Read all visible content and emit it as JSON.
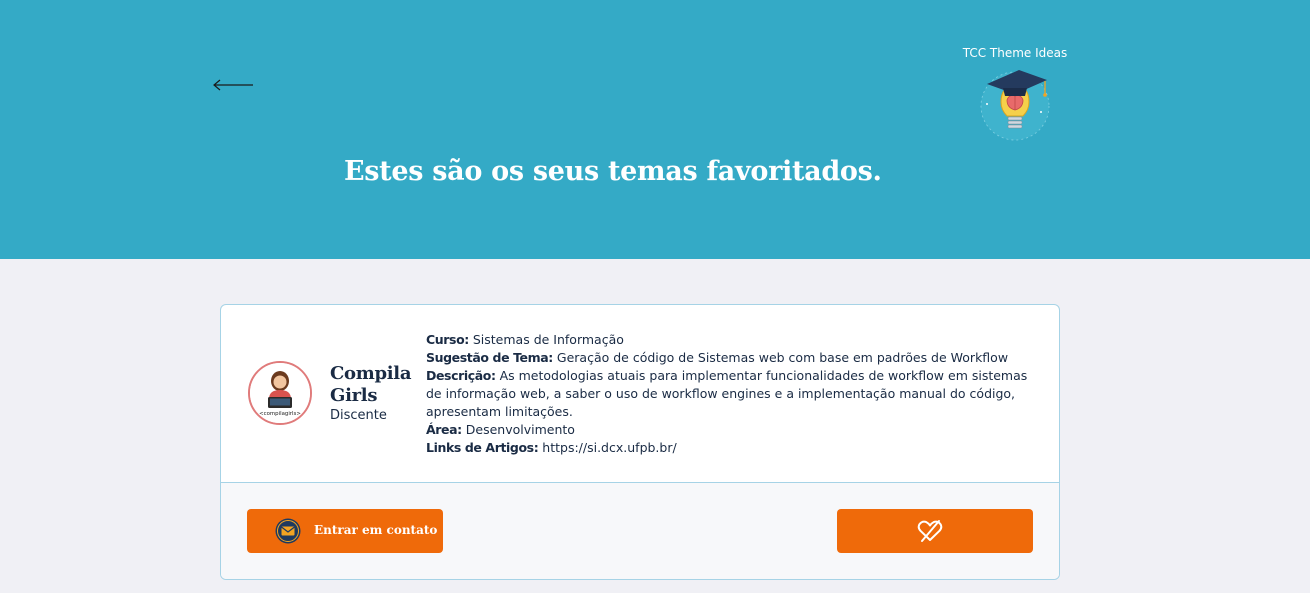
{
  "header": {
    "back_icon": "arrow-left-icon",
    "brand_name": "TCC Theme Ideas",
    "brand_logo_icon": "graduation-cap-lightbulb-icon",
    "title": "Estes são os seus temas favoritados."
  },
  "theme_card": {
    "author": {
      "avatar_icon": "compila-girls-avatar",
      "avatar_caption": "<compilagirls>",
      "name": "Compila Girls",
      "role": "Discente"
    },
    "fields": [
      {
        "label": "Curso:",
        "value": "Sistemas de Informação"
      },
      {
        "label": "Sugestão de Tema:",
        "value": "Geração de código de Sistemas web com base em padrões de Workflow"
      },
      {
        "label": "Descrição:",
        "value": "As metodologias atuais para implementar funcionalidades de workflow em sistemas de informação web, a saber o uso de workflow engines e a implementação manual do código, apresentam limitações."
      },
      {
        "label": "Área:",
        "value": "Desenvolvimento"
      },
      {
        "label": "Links de Artigos:",
        "value": "https://si.dcx.ufpb.br/"
      }
    ],
    "contact_button": {
      "label": "Entrar em contato",
      "icon": "envelope-icon"
    },
    "unfavorite_button": {
      "icon": "heart-crossed-icon"
    }
  },
  "colors": {
    "hero": "#34aac6",
    "accent": "#ef6a0a",
    "text_dark": "#1a2b44",
    "page_bg": "#f0f0f5",
    "card_border": "#a6d3e6"
  }
}
